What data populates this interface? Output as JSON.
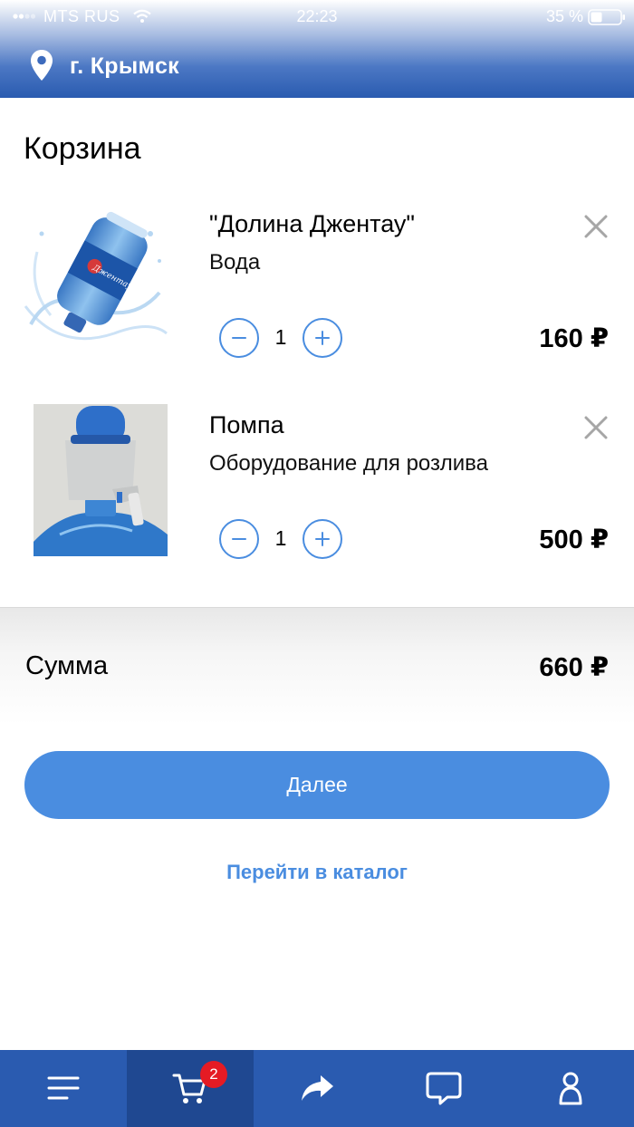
{
  "status_bar": {
    "carrier": "MTS RUS",
    "time": "22:23",
    "battery": "35 %"
  },
  "location": {
    "city": "г. Крымск"
  },
  "page": {
    "title": "Корзина"
  },
  "cart_items": [
    {
      "name": "\"Долина Джентау\"",
      "category": "Вода",
      "quantity": "1",
      "price": "160 ₽",
      "image": "water-bottle-image"
    },
    {
      "name": "Помпа",
      "category": "Оборудование для розлива",
      "quantity": "1",
      "price": "500 ₽",
      "image": "water-pump-image"
    }
  ],
  "summary": {
    "label": "Сумма",
    "total": "660 ₽"
  },
  "actions": {
    "next_label": "Далее",
    "catalog_link": "Перейти в каталог"
  },
  "tab_bar": {
    "tabs": [
      {
        "icon": "menu-icon"
      },
      {
        "icon": "cart-icon",
        "active": true,
        "badge": "2"
      },
      {
        "icon": "share-icon"
      },
      {
        "icon": "chat-icon"
      },
      {
        "icon": "profile-icon"
      }
    ]
  },
  "colors": {
    "accent": "#4a8de0",
    "header_blue": "#2a5bb0",
    "tab_active": "#1f4891",
    "badge_red": "#e51b24"
  }
}
